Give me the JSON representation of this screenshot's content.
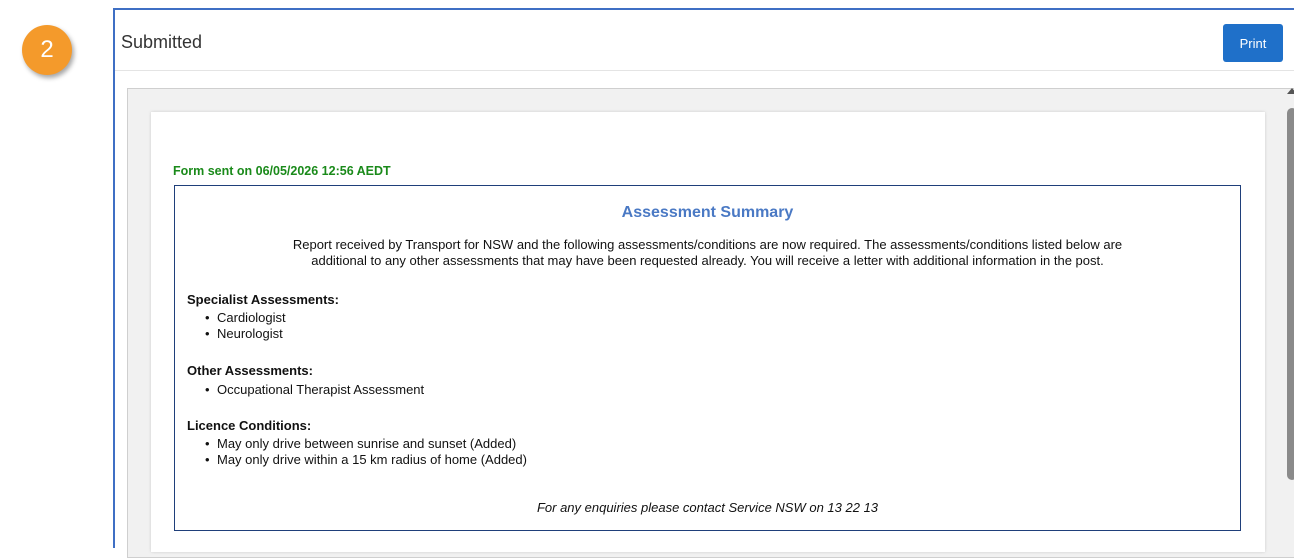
{
  "step_badge": "2",
  "panel": {
    "title": "Submitted",
    "print_label": "Print"
  },
  "document": {
    "sent_line": "Form sent on 06/05/2026 12:56 AEDT",
    "summary": {
      "title": "Assessment Summary",
      "intro_line1": "Report received by Transport for NSW and the following assessments/conditions are now required. The assessments/conditions listed below are",
      "intro_line2": "additional to any other assessments that may have been requested already. You will receive a letter with additional information in the post.",
      "sections": [
        {
          "heading": "Specialist Assessments:",
          "items": [
            "Cardiologist",
            "Neurologist"
          ]
        },
        {
          "heading": "Other Assessments:",
          "items": [
            "Occupational Therapist Assessment"
          ]
        },
        {
          "heading": "Licence Conditions:",
          "items": [
            "May only drive between sunrise and sunset (Added)",
            "May only drive within a 15 km radius of home (Added)"
          ]
        }
      ],
      "footer": "For any enquiries please contact Service NSW on 13 22 13"
    }
  },
  "colors": {
    "badge": "#f49a2b",
    "print_button": "#1f70c9",
    "sent_text": "#1a8a1a",
    "summary_title": "#4a79c4",
    "panel_border": "#3f6fc4"
  }
}
